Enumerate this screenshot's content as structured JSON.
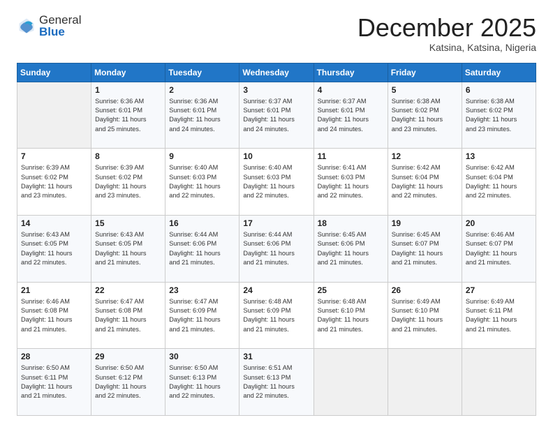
{
  "header": {
    "logo_general": "General",
    "logo_blue": "Blue",
    "month_title": "December 2025",
    "subtitle": "Katsina, Katsina, Nigeria"
  },
  "days_of_week": [
    "Sunday",
    "Monday",
    "Tuesday",
    "Wednesday",
    "Thursday",
    "Friday",
    "Saturday"
  ],
  "weeks": [
    [
      {
        "day": "",
        "info": ""
      },
      {
        "day": "1",
        "info": "Sunrise: 6:36 AM\nSunset: 6:01 PM\nDaylight: 11 hours\nand 25 minutes."
      },
      {
        "day": "2",
        "info": "Sunrise: 6:36 AM\nSunset: 6:01 PM\nDaylight: 11 hours\nand 24 minutes."
      },
      {
        "day": "3",
        "info": "Sunrise: 6:37 AM\nSunset: 6:01 PM\nDaylight: 11 hours\nand 24 minutes."
      },
      {
        "day": "4",
        "info": "Sunrise: 6:37 AM\nSunset: 6:01 PM\nDaylight: 11 hours\nand 24 minutes."
      },
      {
        "day": "5",
        "info": "Sunrise: 6:38 AM\nSunset: 6:02 PM\nDaylight: 11 hours\nand 23 minutes."
      },
      {
        "day": "6",
        "info": "Sunrise: 6:38 AM\nSunset: 6:02 PM\nDaylight: 11 hours\nand 23 minutes."
      }
    ],
    [
      {
        "day": "7",
        "info": "Sunrise: 6:39 AM\nSunset: 6:02 PM\nDaylight: 11 hours\nand 23 minutes."
      },
      {
        "day": "8",
        "info": "Sunrise: 6:39 AM\nSunset: 6:02 PM\nDaylight: 11 hours\nand 23 minutes."
      },
      {
        "day": "9",
        "info": "Sunrise: 6:40 AM\nSunset: 6:03 PM\nDaylight: 11 hours\nand 22 minutes."
      },
      {
        "day": "10",
        "info": "Sunrise: 6:40 AM\nSunset: 6:03 PM\nDaylight: 11 hours\nand 22 minutes."
      },
      {
        "day": "11",
        "info": "Sunrise: 6:41 AM\nSunset: 6:03 PM\nDaylight: 11 hours\nand 22 minutes."
      },
      {
        "day": "12",
        "info": "Sunrise: 6:42 AM\nSunset: 6:04 PM\nDaylight: 11 hours\nand 22 minutes."
      },
      {
        "day": "13",
        "info": "Sunrise: 6:42 AM\nSunset: 6:04 PM\nDaylight: 11 hours\nand 22 minutes."
      }
    ],
    [
      {
        "day": "14",
        "info": "Sunrise: 6:43 AM\nSunset: 6:05 PM\nDaylight: 11 hours\nand 22 minutes."
      },
      {
        "day": "15",
        "info": "Sunrise: 6:43 AM\nSunset: 6:05 PM\nDaylight: 11 hours\nand 21 minutes."
      },
      {
        "day": "16",
        "info": "Sunrise: 6:44 AM\nSunset: 6:06 PM\nDaylight: 11 hours\nand 21 minutes."
      },
      {
        "day": "17",
        "info": "Sunrise: 6:44 AM\nSunset: 6:06 PM\nDaylight: 11 hours\nand 21 minutes."
      },
      {
        "day": "18",
        "info": "Sunrise: 6:45 AM\nSunset: 6:06 PM\nDaylight: 11 hours\nand 21 minutes."
      },
      {
        "day": "19",
        "info": "Sunrise: 6:45 AM\nSunset: 6:07 PM\nDaylight: 11 hours\nand 21 minutes."
      },
      {
        "day": "20",
        "info": "Sunrise: 6:46 AM\nSunset: 6:07 PM\nDaylight: 11 hours\nand 21 minutes."
      }
    ],
    [
      {
        "day": "21",
        "info": "Sunrise: 6:46 AM\nSunset: 6:08 PM\nDaylight: 11 hours\nand 21 minutes."
      },
      {
        "day": "22",
        "info": "Sunrise: 6:47 AM\nSunset: 6:08 PM\nDaylight: 11 hours\nand 21 minutes."
      },
      {
        "day": "23",
        "info": "Sunrise: 6:47 AM\nSunset: 6:09 PM\nDaylight: 11 hours\nand 21 minutes."
      },
      {
        "day": "24",
        "info": "Sunrise: 6:48 AM\nSunset: 6:09 PM\nDaylight: 11 hours\nand 21 minutes."
      },
      {
        "day": "25",
        "info": "Sunrise: 6:48 AM\nSunset: 6:10 PM\nDaylight: 11 hours\nand 21 minutes."
      },
      {
        "day": "26",
        "info": "Sunrise: 6:49 AM\nSunset: 6:10 PM\nDaylight: 11 hours\nand 21 minutes."
      },
      {
        "day": "27",
        "info": "Sunrise: 6:49 AM\nSunset: 6:11 PM\nDaylight: 11 hours\nand 21 minutes."
      }
    ],
    [
      {
        "day": "28",
        "info": "Sunrise: 6:50 AM\nSunset: 6:11 PM\nDaylight: 11 hours\nand 21 minutes."
      },
      {
        "day": "29",
        "info": "Sunrise: 6:50 AM\nSunset: 6:12 PM\nDaylight: 11 hours\nand 22 minutes."
      },
      {
        "day": "30",
        "info": "Sunrise: 6:50 AM\nSunset: 6:13 PM\nDaylight: 11 hours\nand 22 minutes."
      },
      {
        "day": "31",
        "info": "Sunrise: 6:51 AM\nSunset: 6:13 PM\nDaylight: 11 hours\nand 22 minutes."
      },
      {
        "day": "",
        "info": ""
      },
      {
        "day": "",
        "info": ""
      },
      {
        "day": "",
        "info": ""
      }
    ]
  ]
}
